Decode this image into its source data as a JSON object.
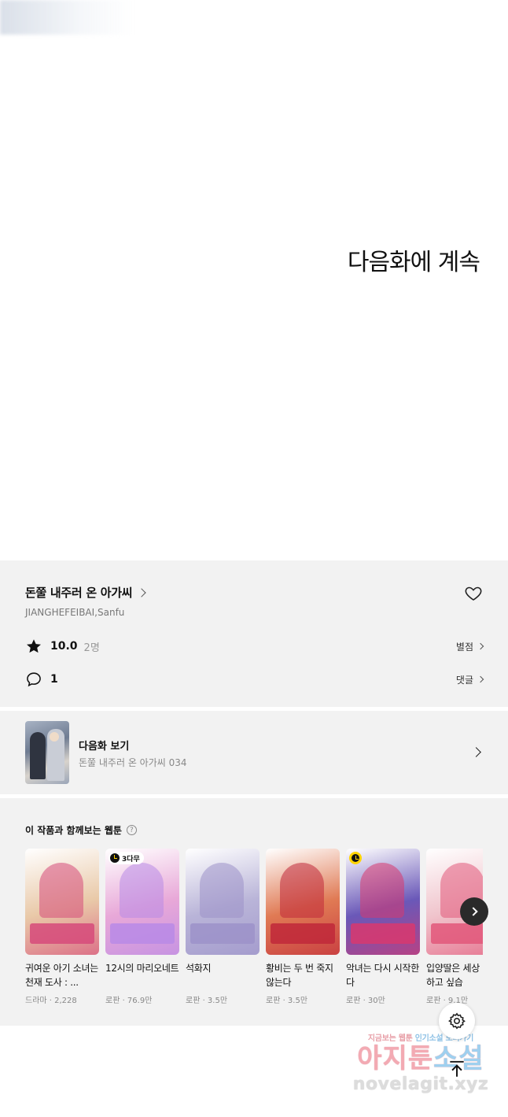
{
  "viewer": {
    "continue_text": "다음화에 계속"
  },
  "series": {
    "title": "돈쭐 내주러 온 아가씨",
    "authors": "JIANGHEFEIBAI,Sanfu",
    "rating": "10.0",
    "rating_count": "2명",
    "rating_link": "별점",
    "comment_count": "1",
    "comment_link": "댓글"
  },
  "next_episode": {
    "label": "다음화 보기",
    "subtitle": "돈쭐 내주러 온 아가씨 034"
  },
  "recommendations": {
    "heading": "이 작품과 함께보는 웹툰",
    "help_glyph": "?",
    "items": [
      {
        "title": "귀여운 아기 소녀는 천재 도사 : ...",
        "meta": "드라마 · 2,228",
        "badge": "",
        "accent": "#e9c9a8",
        "band": "#d64a7a"
      },
      {
        "title": "12시의 마리오네트",
        "meta": "로판 · 76.9만",
        "badge": "3다무",
        "accent": "#e8a8d8",
        "band": "#b88ae6"
      },
      {
        "title": "석화지",
        "meta": "로판 · 3.5만",
        "badge": "",
        "accent": "#b9b4d8",
        "band": "#9c92c9"
      },
      {
        "title": "황비는 두 번 죽지 않는다",
        "meta": "로판 · 3.5만",
        "badge": "",
        "accent": "#e07a54",
        "band": "#c0283a"
      },
      {
        "title": "악녀는 다시 시작한다",
        "meta": "로판 · 30만",
        "badge": "clock",
        "accent": "#6a58b8",
        "band": "#d8386e"
      },
      {
        "title": "입양딸은 세상 구원하고 싶습",
        "meta": "로판 · 9.1만",
        "badge": "",
        "accent": "#f0c4cc",
        "band": "#e2577a"
      }
    ]
  },
  "watermark": {
    "line1_a": "지금보는",
    "line1_b": "웹툰",
    "line1_c": "인기소설",
    "line1_d": "보러가기",
    "line2_a": "아지툰",
    "line2_b": "소설",
    "line3": "novelagit.xyz"
  }
}
